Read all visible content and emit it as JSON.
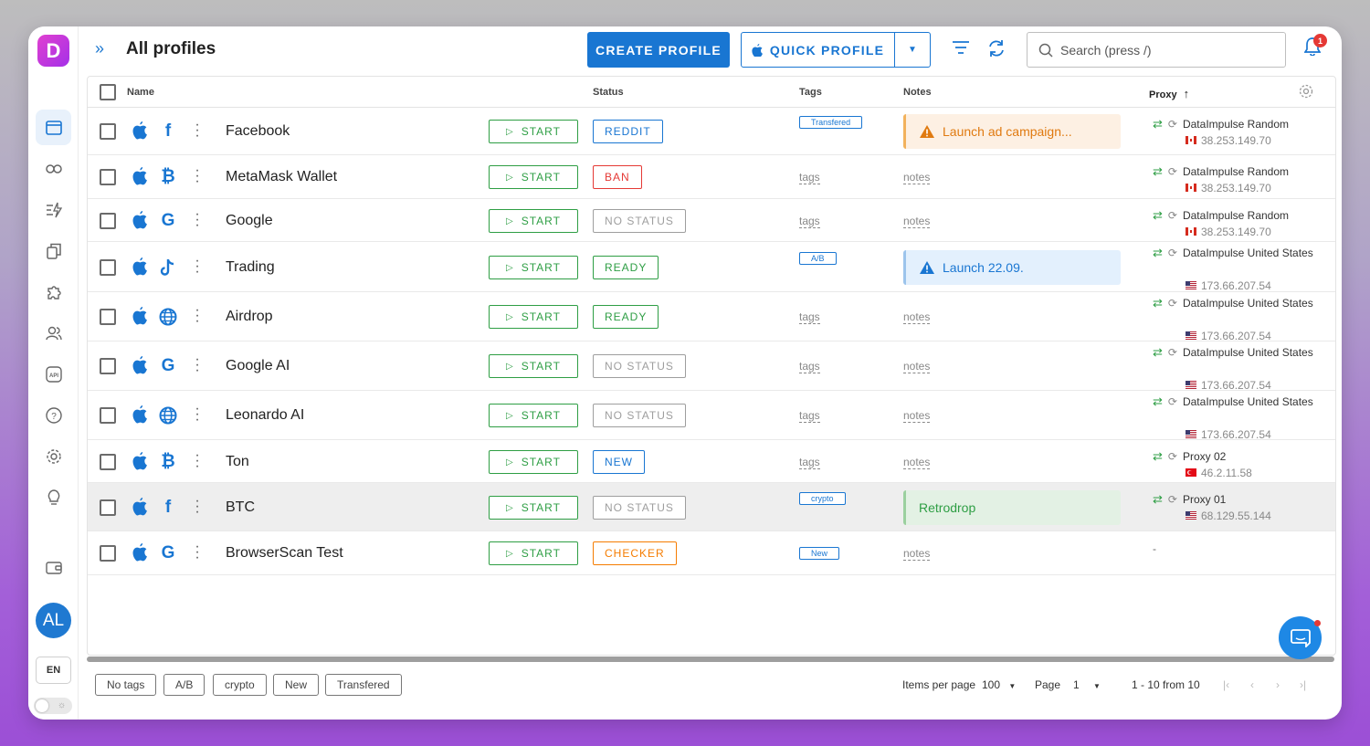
{
  "app": {
    "logo_letter": "D",
    "title": "All profiles"
  },
  "topbar": {
    "create_label": "CREATE PROFILE",
    "quick_label": "QUICK PROFILE",
    "search_placeholder": "Search (press /)",
    "notifications_count": "1"
  },
  "sidebar": {
    "items": [
      "browser-profiles-icon",
      "link-icon",
      "automation-icon",
      "copy-icon",
      "extensions-icon",
      "team-icon",
      "api-icon",
      "help-icon",
      "settings-icon",
      "tips-icon",
      "wallet-icon"
    ],
    "avatar": "AL",
    "language": "EN"
  },
  "table": {
    "headers": {
      "name": "Name",
      "status": "Status",
      "tags": "Tags",
      "notes": "Notes",
      "proxy": "Proxy"
    },
    "rows": [
      {
        "name": "Facebook",
        "icon": "f",
        "start": "START",
        "status": "REDDIT",
        "status_color": "#1976d2",
        "tag": "Transfered",
        "note": "Launch ad campaign...",
        "note_type": "warning",
        "proxy": "DataImpulse Random",
        "ip": "38.253.149.70",
        "flag": "ca"
      },
      {
        "name": "MetaMask Wallet",
        "icon": "₿",
        "start": "START",
        "status": "BAN",
        "status_color": "#e53935",
        "tags_placeholder": "tags",
        "notes_placeholder": "notes",
        "proxy": "DataImpulse Random",
        "ip": "38.253.149.70",
        "flag": "ca"
      },
      {
        "name": "Google",
        "icon": "G",
        "start": "START",
        "status": "NO STATUS",
        "status_color": "#9e9e9e",
        "tags_placeholder": "tags",
        "notes_placeholder": "notes",
        "proxy": "DataImpulse Random",
        "ip": "38.253.149.70",
        "flag": "ca"
      },
      {
        "name": "Trading",
        "icon": "♪",
        "start": "START",
        "status": "READY",
        "status_color": "#2e9e44",
        "tag": "A/B",
        "note": "Launch 22.09.",
        "note_type": "info",
        "proxy": "DataImpulse United States",
        "ip": "173.66.207.54",
        "flag": "us"
      },
      {
        "name": "Airdrop",
        "icon": "globe",
        "start": "START",
        "status": "READY",
        "status_color": "#2e9e44",
        "tags_placeholder": "tags",
        "notes_placeholder": "notes",
        "proxy": "DataImpulse United States",
        "ip": "173.66.207.54",
        "flag": "us"
      },
      {
        "name": "Google AI",
        "icon": "G",
        "start": "START",
        "status": "NO STATUS",
        "status_color": "#9e9e9e",
        "tags_placeholder": "tags",
        "notes_placeholder": "notes",
        "proxy": "DataImpulse United States",
        "ip": "173.66.207.54",
        "flag": "us"
      },
      {
        "name": "Leonardo AI",
        "icon": "globe",
        "start": "START",
        "status": "NO STATUS",
        "status_color": "#9e9e9e",
        "tags_placeholder": "tags",
        "notes_placeholder": "notes",
        "proxy": "DataImpulse United States",
        "ip": "173.66.207.54",
        "flag": "us"
      },
      {
        "name": "Ton",
        "icon": "₿",
        "start": "START",
        "status": "NEW",
        "status_color": "#1976d2",
        "tags_placeholder": "tags",
        "notes_placeholder": "notes",
        "proxy": "Proxy 02",
        "ip": "46.2.11.58",
        "flag": "tr"
      },
      {
        "name": "BTC",
        "icon": "f",
        "start": "START",
        "status": "NO STATUS",
        "status_color": "#9e9e9e",
        "tag": "crypto",
        "note": "Retrodrop",
        "note_type": "success",
        "proxy": "Proxy 01",
        "ip": "68.129.55.144",
        "flag": "us"
      },
      {
        "name": "BrowserScan Test",
        "icon": "G",
        "start": "START",
        "status": "CHECKER",
        "status_color": "#f57c00",
        "tag": "New",
        "notes_placeholder": "notes",
        "proxy_empty": "-"
      }
    ]
  },
  "footer": {
    "chips": [
      "No tags",
      "A/B",
      "crypto",
      "New",
      "Transfered"
    ],
    "items_per_page_label": "Items per page",
    "items_per_page": "100",
    "page_label": "Page",
    "page": "1",
    "range": "1 - 10 from 10"
  }
}
